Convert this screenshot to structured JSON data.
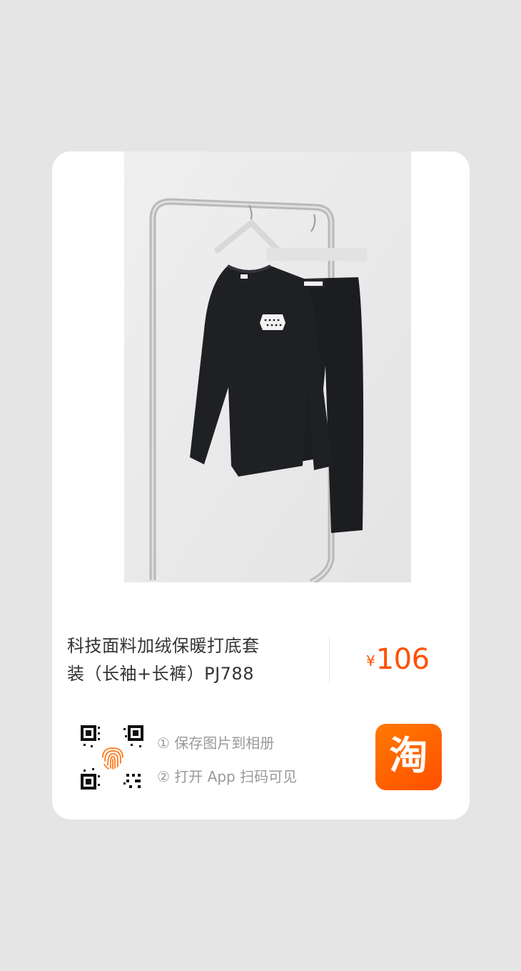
{
  "product": {
    "title_line1": "科技面料加绒保暖打底套",
    "title_line2": "装（长袖+长裤）PJ788",
    "currency": "¥",
    "price": "106"
  },
  "instructions": {
    "step1": "① 保存图片到相册",
    "step2": "② 打开 App 扫码可见"
  },
  "app": {
    "logo_text": "淘",
    "logo_color": "#ff5000"
  },
  "icons": {
    "qr": "qr-code-icon",
    "fingerprint": "fingerprint-icon"
  }
}
